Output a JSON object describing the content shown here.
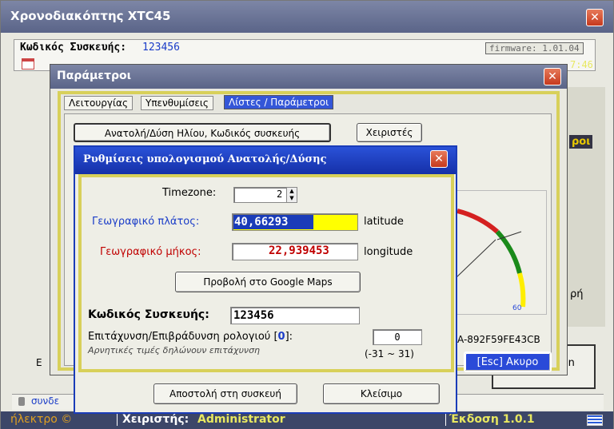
{
  "main_window": {
    "title": "Χρονοδιακόπτης XTC45",
    "device_code_label": "Κωδικός Συσκευής:",
    "device_code_value": "123456",
    "firmware": "firmware: 1.01.04",
    "clock_partial": "7:46",
    "right_partial_1": "ροι",
    "right_partial_2": "ρή",
    "left_partial": "E",
    "status_left": "συνδε",
    "footer_brand": "ήλεκτρο ©",
    "footer_operator_label": "Χειριστής:",
    "footer_operator_value": "Administrator",
    "footer_version": "Έκδοση 1.0.1"
  },
  "params_window": {
    "title": "Παράμετροι",
    "tabs": [
      "Λειτουργίας",
      "Υπενθυμίσεις",
      "Λίστες / Παράμετροι"
    ],
    "active_tab_index": 2,
    "sun_button": "Ανατολή/Δύση Ηλίου, Κωδικός συσκευής",
    "operators_button": "Χειριστές",
    "guid_partial": "A-892F59FE43CB",
    "cancel_button": "[Esc] Ακυρο",
    "gauge_tick_label": "60"
  },
  "dialog": {
    "title": "Ρυθμίσεις υπολογισμού Ανατολής/Δύσης",
    "timezone_label": "Timezone:",
    "timezone_value": "2",
    "latitude_label": "Γεωγραφικό πλάτος:",
    "latitude_value": "40,66293",
    "latitude_unit": "latitude",
    "longitude_label": "Γεωγραφικό μήκος:",
    "longitude_value": "22,939453",
    "longitude_unit": "longitude",
    "maps_button": "Προβολή στο Google Maps",
    "device_code_label": "Κωδικός Συσκευής:",
    "device_code_value": "123456",
    "clock_adjust_label": "Επιτάχυνση/Επιβράδυνση ρολογιού [",
    "clock_adjust_zero": "0",
    "clock_adjust_close": "]:",
    "clock_adjust_value": "0",
    "clock_adjust_note": "Αρνητικές τιμές δηλώνουν επιτάχυνση",
    "clock_adjust_range": "(-31 ~ 31)",
    "send_button": "Αποστολή στη συσκευή",
    "close_button": "Κλείσιμο"
  },
  "colors": {
    "latitude_highlight": "#ffff00",
    "longitude_text": "#c00000",
    "blue_label": "#1a3cc8",
    "dialog_title_bg": "#1a3cb8"
  }
}
